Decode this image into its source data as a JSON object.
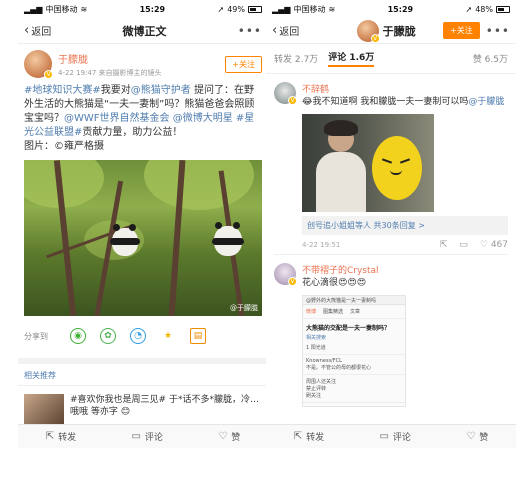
{
  "left": {
    "status": {
      "carrier": "中国移动",
      "time": "15:29",
      "battery": "49%",
      "battery_level": 0.49
    },
    "nav": {
      "back": "返回",
      "title": "微博正文"
    },
    "author": {
      "name": "于朦胧",
      "time": "4-22 19:47",
      "source": "来自摄影博主的镜头",
      "follow": "+关注"
    },
    "post": {
      "tag1": "#地球知识大赛#",
      "t1": "我要对",
      "mention1": "@熊猫守护者",
      "t2": " 提问了：在野外生活的大熊猫是“一夫一妻制”吗？熊猫爸爸会照顾宝宝吗？",
      "mention2": "@WWF世界自然基金会",
      "t3": " ",
      "mention3": "@微博大明星",
      "t4": " ",
      "tag2": "#星光公益联盟#",
      "t5": "贡献力量，助力公益！",
      "t6": "图片：",
      "credit": "©雍严格摄"
    },
    "photo_watermark": "@于朦胧",
    "share": {
      "label": "分享到"
    },
    "related": {
      "title": "相关推荐",
      "text": "#喜欢你我也是周三见# 于*话不多*朦胧，冷…哦哦 等亦字 😊"
    },
    "actions": {
      "repost": "转发",
      "comment": "评论",
      "like": "赞"
    }
  },
  "right": {
    "status": {
      "carrier": "中国移动",
      "time": "15:29",
      "battery": "48%",
      "battery_level": 0.48
    },
    "nav": {
      "back": "返回",
      "title": "于朦胧",
      "follow": "+关注"
    },
    "tabs": {
      "repost": "转发 2.7万",
      "comment": "评论 1.6万",
      "like": "赞 6.5万"
    },
    "comment1": {
      "name": "不辞鹤",
      "text": "😂我不知道啊 我和朦胧一夫一妻制可以吗",
      "mention": "@于朦胧",
      "replies_user": "创号追小姐姐等人",
      "replies_count": "共30条回复 >",
      "time": "4-22 19:51",
      "likes": "467"
    },
    "comment2": {
      "name": "不带褶子的Crystal",
      "text": "花心滴很😍😍😍",
      "ss_url": "@野外的大熊猫是一夫一妻制吗",
      "ss_tab1": "微博",
      "ss_tab2": "图集精选",
      "ss_tab3": "文章",
      "ss_title": "大熊猫的交配是一夫一妻制吗？",
      "ss_sub": "相关搜索",
      "ss_line1": "1 阳光道",
      "ss_line2": "Knowness/FCL",
      "ss_line3": "不是。不管公的母的都很花心",
      "ss_line4": "周围人还关注",
      "ss_line5": "禁止评转",
      "ss_line6": "刷关注"
    },
    "actions": {
      "repost": "转发",
      "comment": "评论",
      "like": "赞"
    }
  },
  "colors": {
    "accent": "#ff8200",
    "link": "#507daf",
    "username": "#eb7350"
  },
  "icons": [
    "chevron-left-icon",
    "more-icon",
    "wechat-icon",
    "moments-icon",
    "qq-icon",
    "qzone-icon",
    "save-icon",
    "repost-icon",
    "comment-icon",
    "like-icon"
  ]
}
